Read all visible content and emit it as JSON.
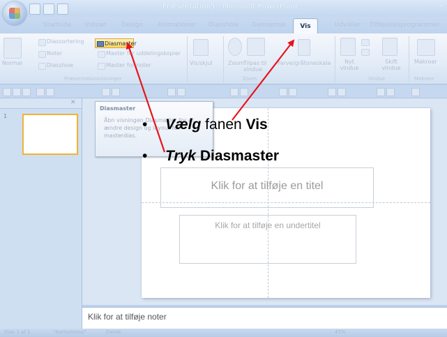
{
  "window": {
    "title": "Præsentation5 - Microsoft PowerPoint",
    "controls": [
      "–",
      "▭",
      "✕"
    ]
  },
  "tabs": [
    "Startside",
    "Indsæt",
    "Design",
    "Animationer",
    "Diasshow",
    "Gennemse",
    "Vis",
    "Udvikler",
    "Tilføjelsesprogrammer"
  ],
  "active_tab": "Vis",
  "ribbon": {
    "normal_label": "Normal",
    "diassortering": "Diassortering",
    "noter": "Noter",
    "diasshow": "Diasshow",
    "diasmaster": "Diasmaster",
    "master_uddeling": "Master for uddelingskopier",
    "master_noter": "Master for noter",
    "group_praesentation": "Præsentationsvisninger",
    "vis_skjul": "Vis/skjul",
    "zoom": "Zoom",
    "tilpas": "Tilpas til vindue",
    "group_zoom": "Zoom",
    "farve": "Farve/gråtoneskala",
    "nyt_vindue": "Nyt vindue",
    "skift_vindue": "Skift vindue",
    "group_vindue": "Vindue",
    "makroer": "Makroer",
    "group_makroer": "Makroer"
  },
  "tooltip": {
    "title": "Diasmaster",
    "body": "Åbn visningen Diasmaster for at ændre design og layout for masterdias."
  },
  "slide": {
    "title_placeholder": "Klik for at tilføje en titel",
    "subtitle_placeholder": "Klik for at tilføje en undertitel"
  },
  "instructions": [
    {
      "bullet": "•",
      "verb": "Vælg",
      "rest": " fanen ",
      "target": "Vis"
    },
    {
      "bullet": "•",
      "verb": "Tryk",
      "rest": " ",
      "target": "Diasmaster"
    }
  ],
  "notes": {
    "placeholder": "Klik for at tilføje noter"
  },
  "status": {
    "slide": "Dias 1 af 1",
    "theme": "\"Kontortema\"",
    "language": "Dansk",
    "zoom": "47%"
  },
  "colors": {
    "arrow": "#e8141b",
    "highlight": "#ffd55e",
    "thumb_border": "#f2b234"
  }
}
